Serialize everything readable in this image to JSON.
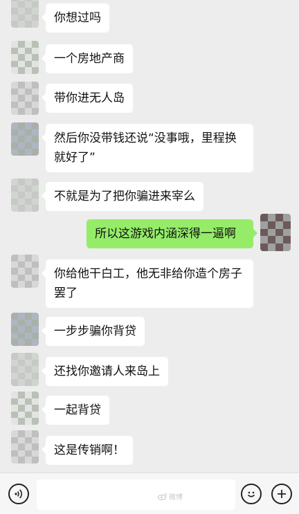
{
  "messages": [
    {
      "side": "in",
      "text": "你想过吗"
    },
    {
      "side": "in",
      "text": "一个房地产商"
    },
    {
      "side": "in",
      "text": "带你进无人岛"
    },
    {
      "side": "in",
      "text": "然后你没带钱还说“没事哦，里程换就好了”"
    },
    {
      "side": "in",
      "text": "不就是为了把你骗进来宰么"
    },
    {
      "side": "out",
      "text": "所以这游戏内涵深得一逼啊"
    },
    {
      "side": "in",
      "text": "你给他干白工，他无非给你造个房子罢了"
    },
    {
      "side": "in",
      "text": "一步步骗你背贷"
    },
    {
      "side": "in",
      "text": "还找你邀请人来岛上"
    },
    {
      "side": "in",
      "text": "一起背贷"
    },
    {
      "side": "in",
      "text": "这是传销啊！"
    }
  ],
  "input_bar": {
    "voice_icon": "voice-icon",
    "emoji_icon": "emoji-icon",
    "plus_icon": "plus-icon",
    "input_value": "",
    "watermark": "微博"
  },
  "colors": {
    "background": "#ededed",
    "incoming_bubble": "#ffffff",
    "outgoing_bubble": "#95ec69"
  }
}
